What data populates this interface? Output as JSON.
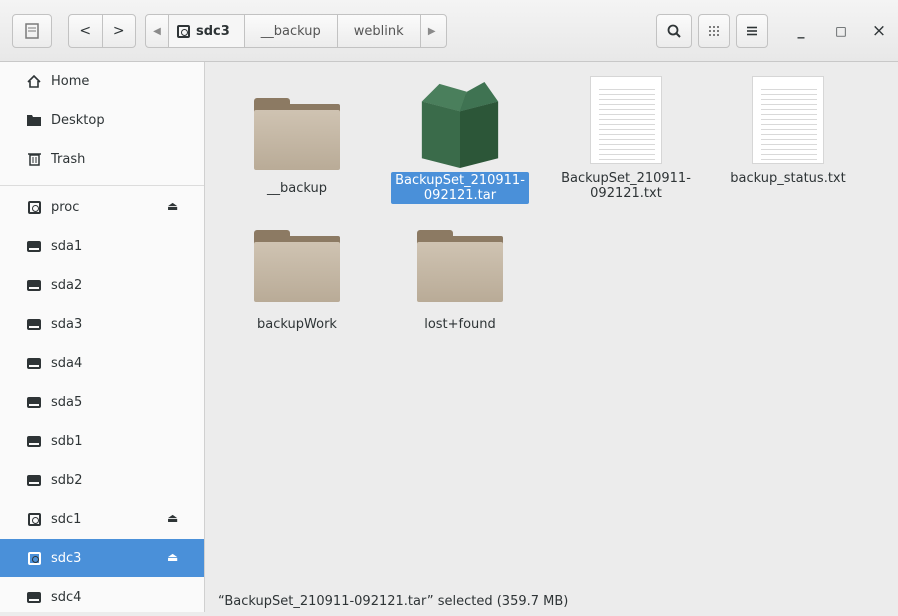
{
  "window": {
    "sidebar_toggle_icon": "sidebar-icon",
    "back_icon": "<",
    "forward_icon": ">",
    "search_icon": "search-icon",
    "view_grid_icon": "grid-icon",
    "menu_icon": "hamburger-icon",
    "minimize": "_",
    "maximize": "□",
    "close": "×"
  },
  "pathbar": {
    "current": "sdc3",
    "segments": [
      "__backup",
      "weblink"
    ]
  },
  "sidebar": {
    "items": [
      {
        "label": "Home"
      },
      {
        "label": "Desktop"
      },
      {
        "label": "Trash"
      },
      {
        "label": "proc"
      },
      {
        "label": "sda1"
      },
      {
        "label": "sda2"
      },
      {
        "label": "sda3"
      },
      {
        "label": "sda4"
      },
      {
        "label": "sda5"
      },
      {
        "label": "sdb1"
      },
      {
        "label": "sdb2"
      },
      {
        "label": "sdc1"
      },
      {
        "label": "sdc3"
      },
      {
        "label": "sdc4"
      }
    ]
  },
  "files": [
    {
      "name": "__backup",
      "type": "folder"
    },
    {
      "name": "BackupSet_210911-\n092121.tar",
      "type": "archive",
      "selected": true
    },
    {
      "name": "BackupSet_210911-\n092121.txt",
      "type": "text"
    },
    {
      "name": "backup_status.txt",
      "type": "text"
    },
    {
      "name": "backupWork",
      "type": "folder"
    },
    {
      "name": "lost+found",
      "type": "folder"
    }
  ],
  "status": "“BackupSet_210911-092121.tar” selected (359.7 MB)",
  "colors": {
    "accent": "#4a90d9",
    "folder": "#c4b7a4",
    "archive": "#355f43"
  }
}
